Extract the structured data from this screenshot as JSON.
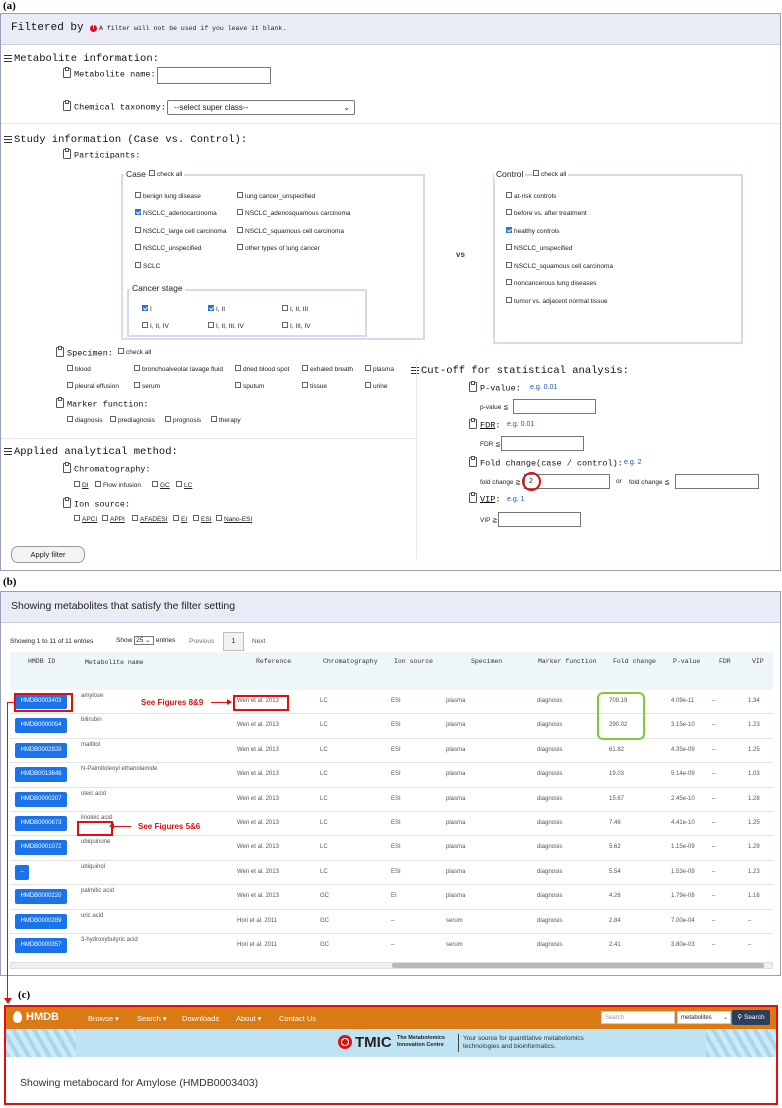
{
  "labels": {
    "a": "(a)",
    "b": "(b)",
    "c": "(c)"
  },
  "filter": {
    "title": "Filtered by",
    "note": "A filter will not be used if you leave it blank.",
    "metabolite": {
      "title": "Metabolite information:",
      "name_label": "Metabolite name:",
      "taxonomy_label": "Chemical taxonomy:",
      "taxonomy_value": "--select super class--"
    },
    "study": {
      "title": "Study information (Case vs. Control):",
      "participants": "Participants:",
      "case_title": "Case",
      "check_all": "check all",
      "case_items": [
        "benign lung disease",
        "lung cancer_unspecified",
        "NSCLC_adenocarcinoma",
        "NSCLC_adenosquamous carcinoma",
        "NSCLC_large cell carcinoma",
        "NSCLC_squamous cell carcinoma",
        "NSCLC_unspecified",
        "other types of lung cancer",
        "SCLC"
      ],
      "stage_title": "Cancer stage",
      "stages": [
        "I",
        "I, II",
        "I, II, III",
        "I, II, IV",
        "I, II, III, IV",
        "I, III, IV"
      ],
      "vs": "vs",
      "control_title": "Control",
      "control_items": [
        "at-risk controls",
        "before vs. after treatment",
        "healthy controls",
        "NSCLC_unspecified",
        "NSCLC_squamous cell carcinoma",
        "noncancerous lung diseases",
        "tumor vs. adjacent normal tissue"
      ],
      "specimen_label": "Specimen:",
      "specimens": [
        "blood",
        "bronchoalveolar lavage fluid",
        "dried blood spot",
        "exhaled breath",
        "plasma",
        "pleural effusion",
        "serum",
        "sputum",
        "tissue",
        "urine"
      ],
      "marker_label": "Marker function:",
      "markers": [
        "diagnosis",
        "prediagnosis",
        "prognosis",
        "therapy"
      ]
    },
    "method": {
      "title": "Applied analytical method:",
      "chrom_label": "Chromatography:",
      "chrom": [
        "DI",
        "Flow infusion",
        "GC",
        "LC"
      ],
      "ion_label": "Ion source:",
      "ions": [
        "APCI",
        "APPI",
        "AFADESI",
        "EI",
        "ESI",
        "Nano-ESI"
      ]
    },
    "cutoff": {
      "title": "Cut-off for statistical analysis:",
      "pvalue": "P-value:",
      "pvalue_eg": "e.g. 0.01",
      "pvalue_field": "p-value ≦",
      "fdr": "FDR",
      "fdr_eg": "e.g. 0.01",
      "fdr_field": "FDR ≦",
      "fold": "Fold change(case / control):",
      "fold_eg": "e.g. 2",
      "fold_field": "fold change ≧",
      "fold_value": "2",
      "or": "or",
      "fold_field2": "fold change ≦",
      "vip": "VIP",
      "vip_eg": "e.g. 1",
      "vip_field": "VIP ≧"
    },
    "apply": "Apply filter"
  },
  "results": {
    "title": "Showing metabolites that satisfy the filter setting",
    "entries_info": "Showing 1 to 11 of 11 entries",
    "show": "Show",
    "show_value": "25",
    "entries": "entries",
    "previous": "Previous",
    "page": "1",
    "next": "Next",
    "columns": [
      "HMDB ID",
      "Metabolite name",
      "Reference",
      "Chromatography",
      "Ion source",
      "Specimen",
      "Marker function",
      "Fold change",
      "P-value",
      "FDR",
      "VIP"
    ],
    "rows": [
      [
        "HMDB0003403",
        "amylose",
        "Wen et al. 2013",
        "LC",
        "ESI",
        "plasma",
        "diagnosis",
        "709.19",
        "4.09e-11",
        "–",
        "1.34"
      ],
      [
        "HMDB0000054",
        "bilirubin",
        "Wen et al. 2013",
        "LC",
        "ESI",
        "plasma",
        "diagnosis",
        "290.02",
        "3.15e-10",
        "–",
        "1.23"
      ],
      [
        "HMDB0002928",
        "maltitol",
        "Wen et al. 2013",
        "LC",
        "ESI",
        "plasma",
        "diagnosis",
        "61.82",
        "4.35e-09",
        "–",
        "1.25"
      ],
      [
        "HMDB0013648",
        "N-Palmitoleoyl ethanolamide",
        "Wen et al. 2013",
        "LC",
        "ESI",
        "plasma",
        "diagnosis",
        "19.03",
        "5.14e-09",
        "–",
        "1.03"
      ],
      [
        "HMDB0000207",
        "oleic acid",
        "Wen et al. 2013",
        "LC",
        "ESI",
        "plasma",
        "diagnosis",
        "15.67",
        "2.45e-10",
        "–",
        "1.28"
      ],
      [
        "HMDB0000673",
        "linoleic acid",
        "Wen et al. 2013",
        "LC",
        "ESI",
        "plasma",
        "diagnosis",
        "7.46",
        "4.41e-10",
        "–",
        "1.25"
      ],
      [
        "HMDB0001072",
        "ubiquinone",
        "Wen et al. 2013",
        "LC",
        "ESI",
        "plasma",
        "diagnosis",
        "5.62",
        "1.15e-09",
        "–",
        "1.29"
      ],
      [
        "–",
        "ubiquinol",
        "Wen et al. 2013",
        "LC",
        "ESI",
        "plasma",
        "diagnosis",
        "5.54",
        "1.53e-09",
        "–",
        "1.23"
      ],
      [
        "HMDB0000220",
        "palmitic acid",
        "Wen et al. 2013",
        "GC",
        "EI",
        "plasma",
        "diagnosis",
        "4.26",
        "1.79e-08",
        "–",
        "1.16"
      ],
      [
        "HMDB0000289",
        "uric acid",
        "Hori et al. 2011",
        "GC",
        "–",
        "serum",
        "diagnosis",
        "2.84",
        "7.00e-04",
        "–",
        "–"
      ],
      [
        "HMDB0000357",
        "3-hydroxybutyric acid",
        "Hori et al. 2011",
        "GC",
        "–",
        "serum",
        "diagnosis",
        "2.41",
        "3.80e-03",
        "–",
        "–"
      ]
    ],
    "ann1": "See Figures 8&9",
    "ann2": "See Figures 5&6"
  },
  "hmdb": {
    "logo": "HMDB",
    "nav": [
      "Browse ▾",
      "Search ▾",
      "Downloads",
      "About ▾",
      "Contact Us"
    ],
    "search_placeholder": "Search",
    "select_value": "metabolites",
    "search_btn": "Search",
    "tmic": "TMIC",
    "tmic_sub1": "The Metabolomics",
    "tmic_sub2": "Innovation Centre",
    "tag1": "Your source for quantitative metabolomics",
    "tag2": "technologies and bioinformatics.",
    "metacard": "Showing metabocard for Amylose (HMDB0003403)",
    "colors": {
      "bar": "#d97a14",
      "banner": "#bfe3f3"
    }
  }
}
